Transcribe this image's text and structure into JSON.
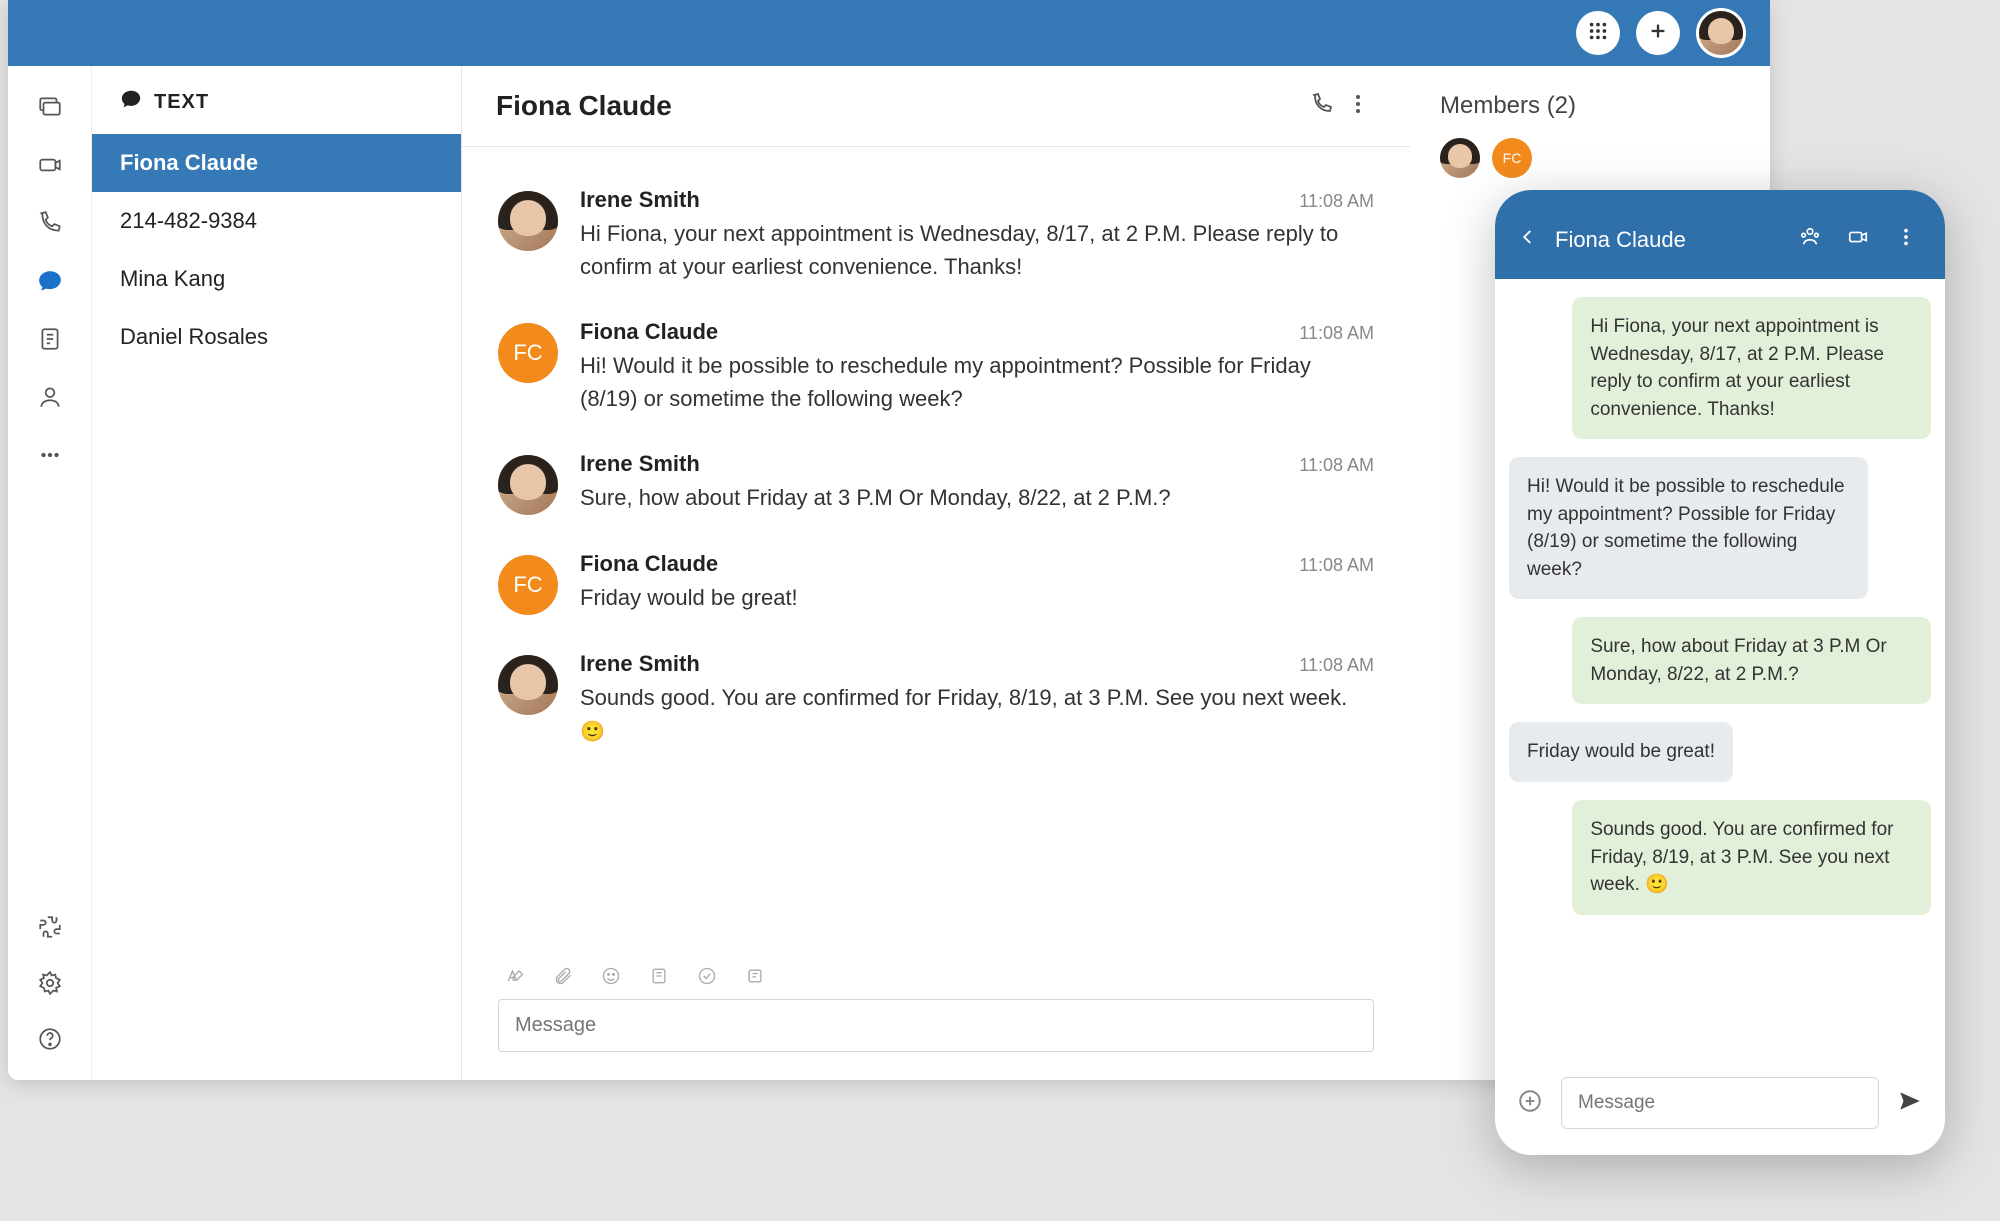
{
  "topbar": {
    "dialpad_tooltip": "Dialpad",
    "add_tooltip": "Add"
  },
  "sidebar": {
    "section_label": "TEXT",
    "conversations": [
      {
        "name": "Fiona Claude",
        "selected": true
      },
      {
        "name": "214-482-9384",
        "selected": false
      },
      {
        "name": "Mina Kang",
        "selected": false
      },
      {
        "name": "Daniel Rosales",
        "selected": false
      }
    ]
  },
  "chat": {
    "title": "Fiona Claude",
    "messages": [
      {
        "sender": "Irene Smith",
        "avatar_type": "photo",
        "initials": "",
        "time": "11:08 AM",
        "text": "Hi Fiona, your next appointment is Wednesday, 8/17, at 2 P.M. Please reply to confirm at your earliest convenience. Thanks!",
        "emoji": ""
      },
      {
        "sender": "Fiona Claude",
        "avatar_type": "initials",
        "initials": "FC",
        "time": "11:08 AM",
        "text": "Hi! Would it be possible to  reschedule my appointment? Possible for Friday (8/19) or sometime the following week?",
        "emoji": ""
      },
      {
        "sender": "Irene Smith",
        "avatar_type": "photo",
        "initials": "",
        "time": "11:08 AM",
        "text": "Sure, how about Friday at 3 P.M Or Monday, 8/22, at 2 P.M.?",
        "emoji": ""
      },
      {
        "sender": "Fiona Claude",
        "avatar_type": "initials",
        "initials": "FC",
        "time": "11:08 AM",
        "text": "Friday would be great!",
        "emoji": ""
      },
      {
        "sender": "Irene Smith",
        "avatar_type": "photo",
        "initials": "",
        "time": "11:08 AM",
        "text": "Sounds good. You are confirmed for Friday, 8/19, at 3 P.M. See you next week. ",
        "emoji": "🙂"
      }
    ],
    "composer_placeholder": "Message"
  },
  "members": {
    "title": "Members (2)",
    "list": [
      {
        "type": "photo",
        "initials": ""
      },
      {
        "type": "initials",
        "initials": "FC"
      }
    ]
  },
  "mobile": {
    "title": "Fiona Claude",
    "bubbles": [
      {
        "dir": "out",
        "text": "Hi Fiona, your next appointment is Wednesday, 8/17, at 2 P.M. Please reply to confirm at your earliest convenience. Thanks!",
        "emoji": ""
      },
      {
        "dir": "in",
        "text": "Hi! Would it be possible to reschedule my appointment? Possible for Friday (8/19) or sometime the following week?",
        "emoji": ""
      },
      {
        "dir": "out",
        "text": "Sure, how about Friday at 3 P.M Or Monday, 8/22, at 2 P.M.?",
        "emoji": ""
      },
      {
        "dir": "in",
        "text": "Friday would be great!",
        "emoji": ""
      },
      {
        "dir": "out",
        "text": "Sounds good. You are confirmed for Friday, 8/19, at 3 P.M. See you next week. ",
        "emoji": "🙂"
      }
    ],
    "composer_placeholder": "Message"
  }
}
